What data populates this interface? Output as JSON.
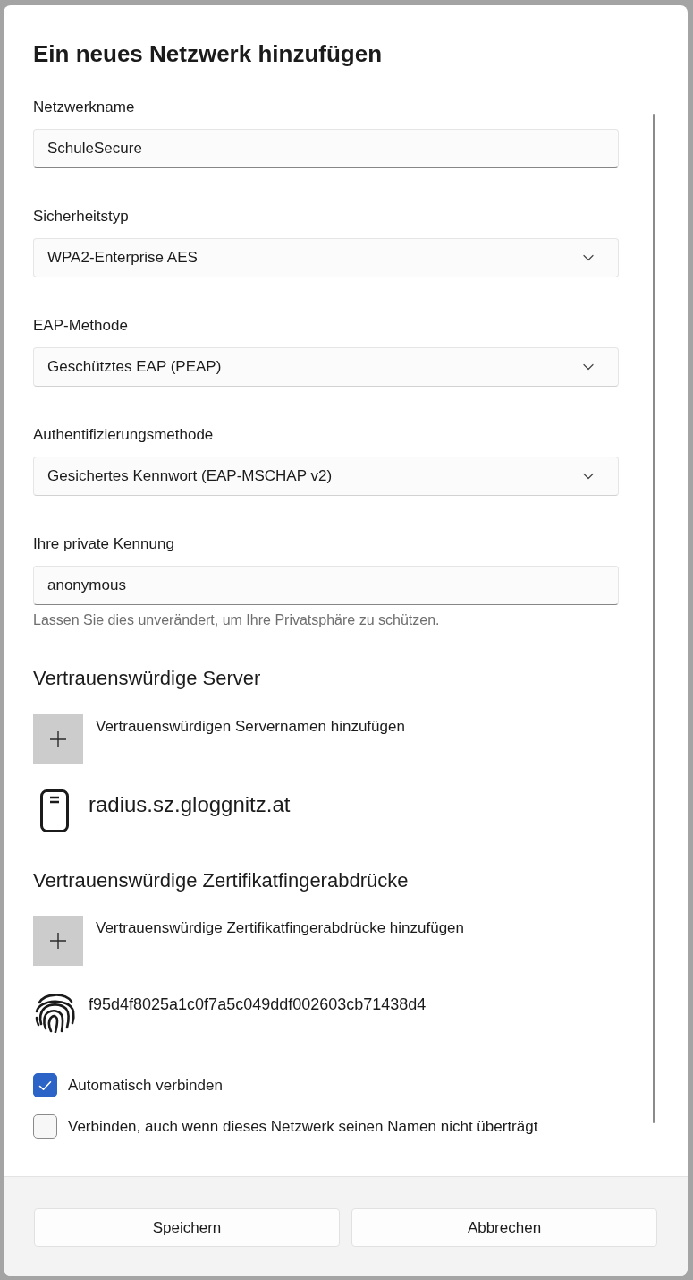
{
  "dialog": {
    "title": "Ein neues Netzwerk hinzufügen"
  },
  "fields": [
    {
      "kind": "text",
      "label": "Netzwerkname",
      "value": "SchuleSecure"
    },
    {
      "kind": "select",
      "label": "Sicherheitstyp",
      "value": "WPA2-Enterprise AES"
    },
    {
      "kind": "select",
      "label": "EAP-Methode",
      "value": "Geschütztes EAP (PEAP)"
    },
    {
      "kind": "select",
      "label": "Authentifizierungsmethode",
      "value": "Gesichertes Kennwort (EAP-MSCHAP v2)"
    },
    {
      "kind": "text",
      "label": "Ihre private Kennung",
      "value": "anonymous",
      "hint": "Lassen Sie dies unverändert, um Ihre Privatsphäre zu schützen."
    }
  ],
  "trusted_servers": {
    "heading": "Vertrauenswürdige Server",
    "add_label": "Vertrauenswürdigen Servernamen hinzufügen",
    "items": [
      {
        "name": "radius.sz.gloggnitz.at"
      }
    ]
  },
  "trusted_fingerprints": {
    "heading": "Vertrauenswürdige Zertifikatfingerabdrücke",
    "add_label": "Vertrauenswürdige Zertifikatfingerabdrücke hinzufügen",
    "items": [
      {
        "value": "f95d4f8025a1c0f7a5c049ddf002603cb71438d4"
      }
    ]
  },
  "checkboxes": [
    {
      "label": "Automatisch verbinden",
      "checked": true
    },
    {
      "label": "Verbinden, auch wenn dieses Netzwerk seinen Namen nicht überträgt",
      "checked": false
    }
  ],
  "buttons": [
    "Speichern",
    "Abbrechen"
  ]
}
